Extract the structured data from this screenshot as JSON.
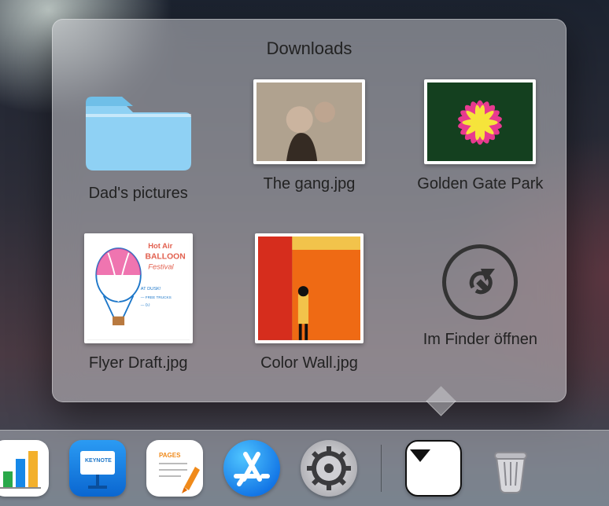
{
  "stack": {
    "title": "Downloads",
    "items": [
      {
        "label": "Dad's pictures",
        "kind": "folder"
      },
      {
        "label": "The gang.jpg",
        "kind": "image-gang"
      },
      {
        "label": "Golden Gate Park",
        "kind": "image-flower"
      },
      {
        "label": "Flyer Draft.jpg",
        "kind": "image-flyer"
      },
      {
        "label": "Color Wall.jpg",
        "kind": "image-wall"
      },
      {
        "label": "Im Finder öffnen",
        "kind": "open-finder"
      }
    ]
  },
  "dock": {
    "items": [
      {
        "name": "numbers-app"
      },
      {
        "name": "keynote-app"
      },
      {
        "name": "pages-app"
      },
      {
        "name": "app-store"
      },
      {
        "name": "system-settings"
      }
    ],
    "right": [
      {
        "name": "downloads-stack"
      },
      {
        "name": "trash"
      }
    ]
  }
}
